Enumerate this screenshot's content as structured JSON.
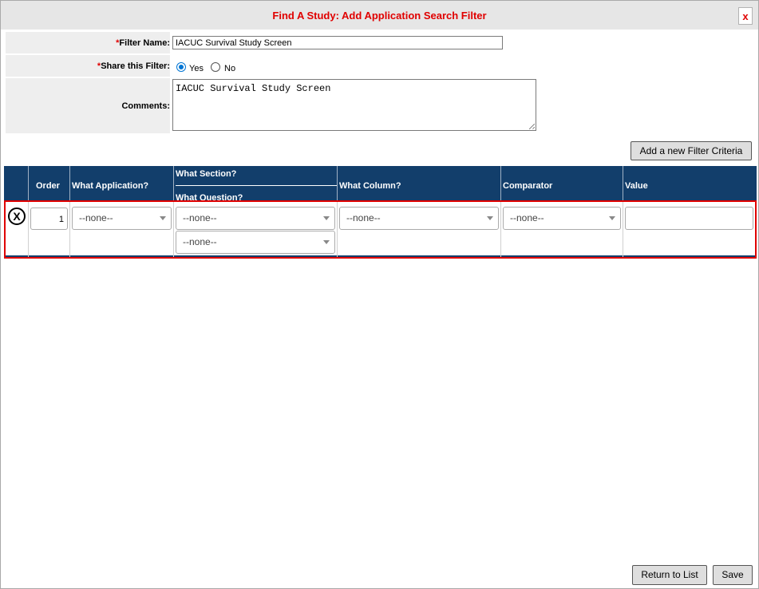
{
  "dialog": {
    "title": "Find A Study: Add Application Search Filter",
    "close_label": "x"
  },
  "form": {
    "required_marker": "*",
    "filter_name_label": "Filter Name:",
    "filter_name_value": "IACUC Survival Study Screen",
    "share_label": "Share this Filter:",
    "share_options": [
      {
        "label": "Yes",
        "selected": true
      },
      {
        "label": "No",
        "selected": false
      }
    ],
    "comments_label": "Comments:",
    "comments_value": "IACUC Survival Study Screen"
  },
  "toolbar": {
    "add_criteria_label": "Add a new Filter Criteria"
  },
  "table": {
    "headers": {
      "order": "Order",
      "application": "What Application?",
      "section": "What Section?",
      "question": "What Question?",
      "column": "What Column?",
      "comparator": "Comparator",
      "value": "Value"
    },
    "header_color": "#123e6b",
    "highlight_color": "#e00000",
    "rows": [
      {
        "remove_icon": "remove-circle-x-icon",
        "remove_glyph": "X",
        "order": "1",
        "application": "--none--",
        "section": "--none--",
        "question": "--none--",
        "column": "--none--",
        "comparator": "--none--",
        "value": ""
      }
    ]
  },
  "footer": {
    "return_label": "Return to List",
    "save_label": "Save"
  }
}
